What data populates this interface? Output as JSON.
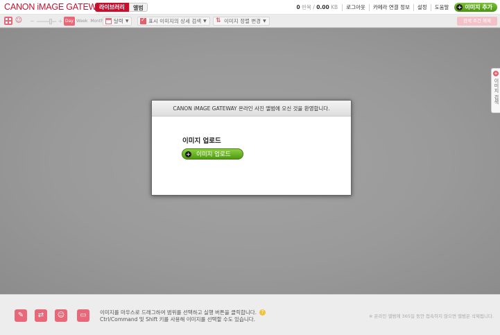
{
  "header": {
    "logo": "CANON iMAGE GATEWAY",
    "tab_library": "라이브러리",
    "tab_album": "앨범",
    "storage_used": "0",
    "storage_used_unit": "반복 /",
    "storage_total": "0.00",
    "storage_total_unit": "KB",
    "links": [
      "로그아웃",
      "카메라 연결 정보",
      "설정",
      "도움말"
    ],
    "add_image": "이미지 추가"
  },
  "toolbar": {
    "zoom_minus": "−",
    "zoom_plus": "+",
    "period": [
      "Day",
      "Week",
      "Month"
    ],
    "period_selected": "Day",
    "calendar_label": "달력",
    "detail_search_label": "표시 이미지의 상세 검색",
    "sort_label": "이미지 정렬 변경",
    "search_condition": "검색 조건 해제"
  },
  "side_tab": {
    "label": "이미지 검색"
  },
  "dialog": {
    "welcome": "CANON iMAGE GATEWAY 온라인 사진 앨범에 오신 것을 환영합니다.",
    "upload_title": "이미지 업로드",
    "upload_button": "이미지 업로드"
  },
  "footer": {
    "line1": "이미지를 마우스로 드래그하여 범위를 선택하고 실행 버튼을 클릭합니다.",
    "line2": "Ctrl/Command 및 Shift 키를 사용해 이미지를 선택할 수도 있습니다.",
    "note": "※ 온라인 앨범에 365일 동안 접속하지 않으면 앨범은 삭제됩니다."
  },
  "colors": {
    "brand_red": "#c8102e",
    "accent_pink": "#e8687a",
    "green": "#5aa91a",
    "background_gray": "#9a9a9a"
  },
  "icons": {
    "grid_view": "grid-view-icon",
    "face_view": "face-view-icon",
    "calendar": "calendar-icon",
    "checkbox": "checkbox-icon",
    "sort": "sort-icon",
    "footer_actions": [
      "edit-icon",
      "transfer-icon",
      "share-icon",
      "slideshow-icon"
    ]
  }
}
